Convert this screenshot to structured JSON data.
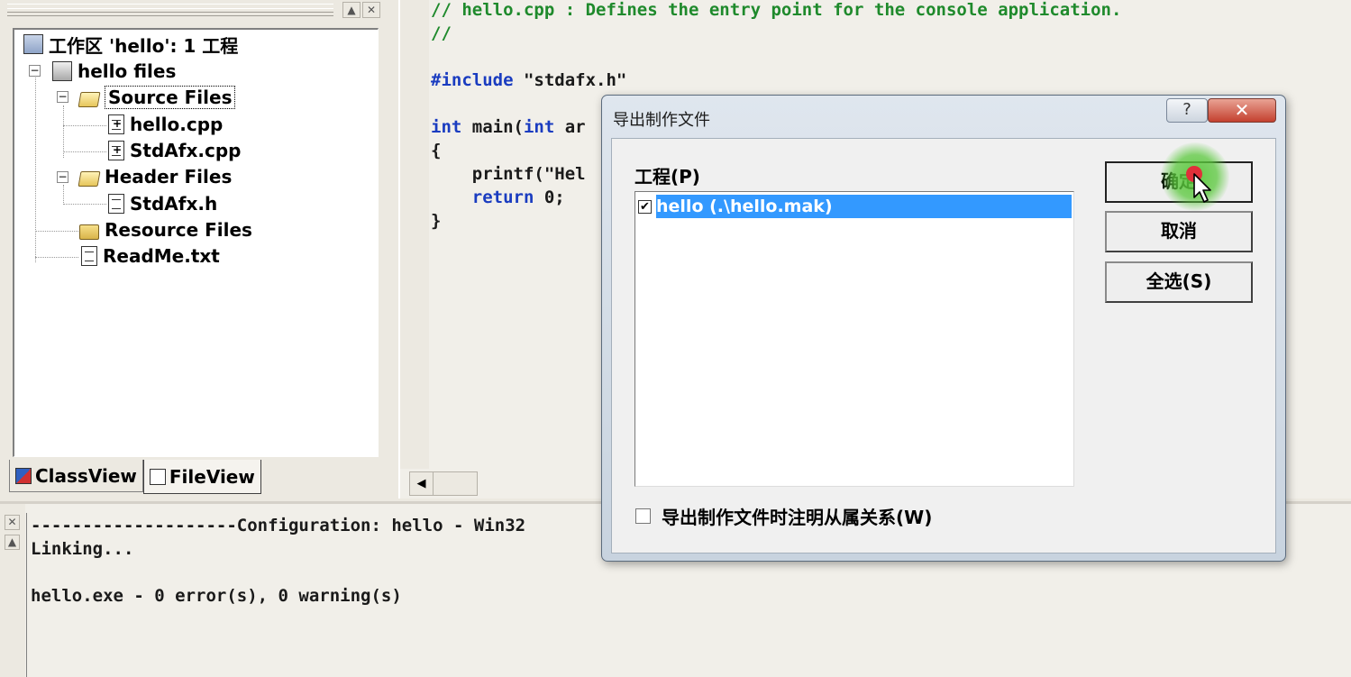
{
  "workspace": {
    "root_label": "工作区 'hello': 1 工程",
    "project_label": "hello files",
    "nodes": {
      "source_files": "Source Files",
      "hello_cpp": "hello.cpp",
      "stdafx_cpp": "StdAfx.cpp",
      "header_files": "Header Files",
      "stdafx_h": "StdAfx.h",
      "resource_files": "Resource Files",
      "readme": "ReadMe.txt"
    },
    "tabs": {
      "classview": "ClassView",
      "fileview": "FileView"
    }
  },
  "editor": {
    "lines": {
      "l1": "// hello.cpp : Defines the entry point for the console application.",
      "l2": "//",
      "l3_directive": "#include",
      "l3_file": " \"stdafx.h\"",
      "l4_kw1": "int",
      "l4_mid": " main(",
      "l4_kw2": "int",
      "l4_rest": " ar",
      "l5": "{",
      "l6": "    printf(\"Hel",
      "l7_kw": "    return",
      "l7_rest": " 0;",
      "l8": "}"
    }
  },
  "output": {
    "lines": [
      "--------------------Configuration: hello - Win32",
      "Linking...",
      "",
      "hello.exe - 0 error(s), 0 warning(s)"
    ]
  },
  "dialog": {
    "title": "导出制作文件",
    "help": "?",
    "close": "✕",
    "project_label": "工程(P)",
    "project_item": "hello  (.\\hello.mak)",
    "project_item_checked": true,
    "buttons": {
      "ok": "确定",
      "cancel": "取消",
      "select_all": "全选(S)"
    },
    "dependencies_label": "导出制作文件时注明从属关系(W)",
    "dependencies_checked": false
  },
  "colors": {
    "comment": "#1f8a2c",
    "keyword": "#1a3cc0",
    "selection": "#3399ff",
    "cursor_highlight": "#5ac83c"
  },
  "icons": {
    "checkmark": "✔",
    "scroll_left": "◀"
  }
}
